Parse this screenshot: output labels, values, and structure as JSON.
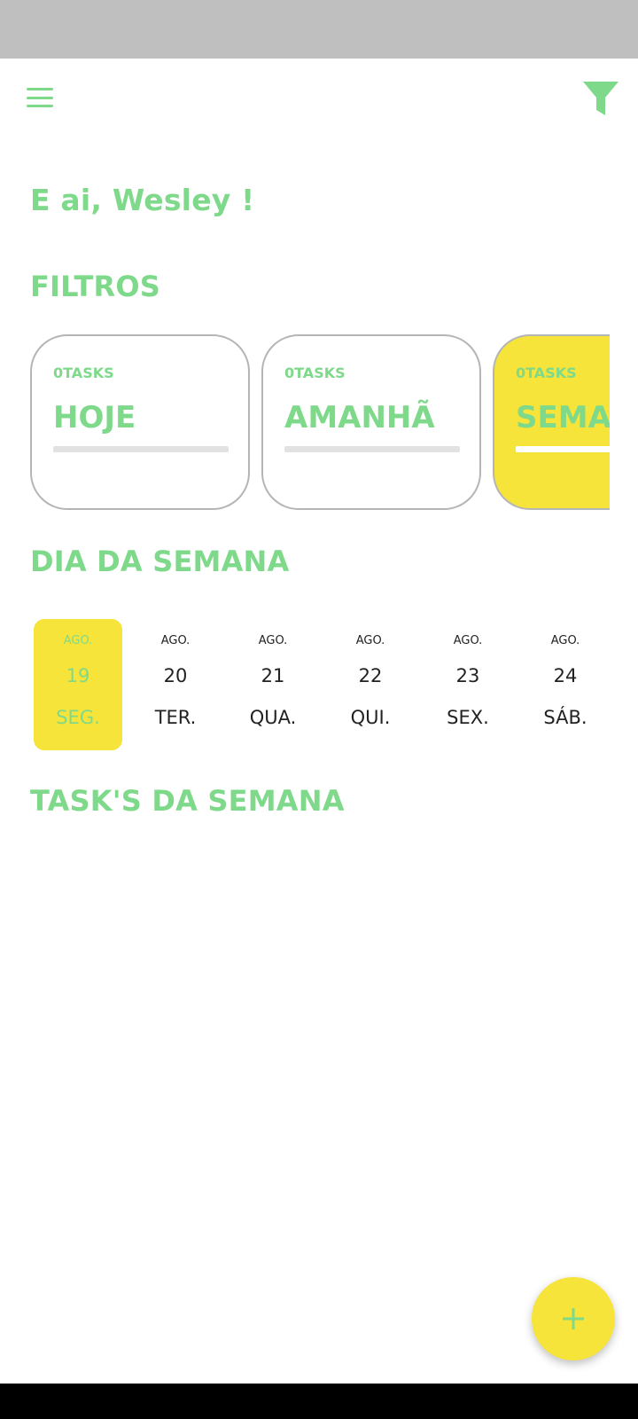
{
  "greeting": "E ai, Wesley !",
  "sections": {
    "filters_title": "FILTROS",
    "weekday_title": "DIA DA SEMANA",
    "tasks_title": "TASK'S DA SEMANA"
  },
  "filters": [
    {
      "count": "0TASKS",
      "label": "HOJE",
      "active": false
    },
    {
      "count": "0TASKS",
      "label": "AMANHÃ",
      "active": false
    },
    {
      "count": "0TASKS",
      "label": "SEMANA",
      "active": true
    }
  ],
  "days": [
    {
      "month": "AGO.",
      "day": "19",
      "weekday": "SEG.",
      "selected": true
    },
    {
      "month": "AGO.",
      "day": "20",
      "weekday": "TER.",
      "selected": false
    },
    {
      "month": "AGO.",
      "day": "21",
      "weekday": "QUA.",
      "selected": false
    },
    {
      "month": "AGO.",
      "day": "22",
      "weekday": "QUI.",
      "selected": false
    },
    {
      "month": "AGO.",
      "day": "23",
      "weekday": "SEX.",
      "selected": false
    },
    {
      "month": "AGO.",
      "day": "24",
      "weekday": "SÁB.",
      "selected": false
    }
  ],
  "icons": {
    "menu": "menu-icon",
    "filter": "filter-icon",
    "add": "plus-icon"
  },
  "colors": {
    "accent_green": "#7ed98a",
    "accent_yellow": "#f6e43a",
    "status_bar": "#bfbfbf"
  }
}
